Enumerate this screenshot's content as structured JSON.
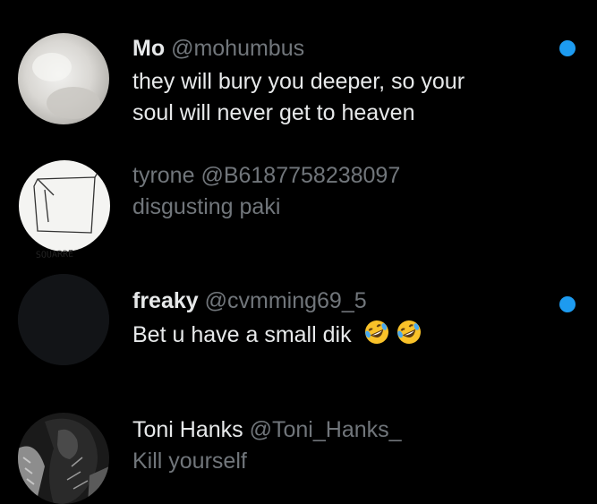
{
  "colors": {
    "background": "#000000",
    "primary_text": "#e7e9ea",
    "secondary_text": "#71767b",
    "unread_dot": "#1d9bf0"
  },
  "messages": [
    {
      "name": "Mo",
      "handle": "@mohumbus",
      "text_lines": [
        "they will bury you deeper, so your",
        "soul will never get to heaven"
      ],
      "unread": true,
      "avatar": "blurred-photo-avatar"
    },
    {
      "name": "tyrone",
      "handle": "@B6187758238097",
      "text_lines": [
        "disgusting paki"
      ],
      "unread": false,
      "avatar": "sketch-drawing-avatar",
      "avatar_caption": "SQUARRE"
    },
    {
      "name": "freaky",
      "handle": "@cvmming69_5",
      "text_lines": [
        "Bet u have a small dik"
      ],
      "emojis": [
        "rolling-on-floor-laughing-emoji",
        "rolling-on-floor-laughing-emoji"
      ],
      "unread": true,
      "avatar": "dark-empty-avatar"
    },
    {
      "name": "Toni Hanks",
      "handle": "@Toni_Hanks_",
      "text_lines": [
        "Kill yourself"
      ],
      "unread": false,
      "avatar": "dark-photo-avatar"
    }
  ]
}
